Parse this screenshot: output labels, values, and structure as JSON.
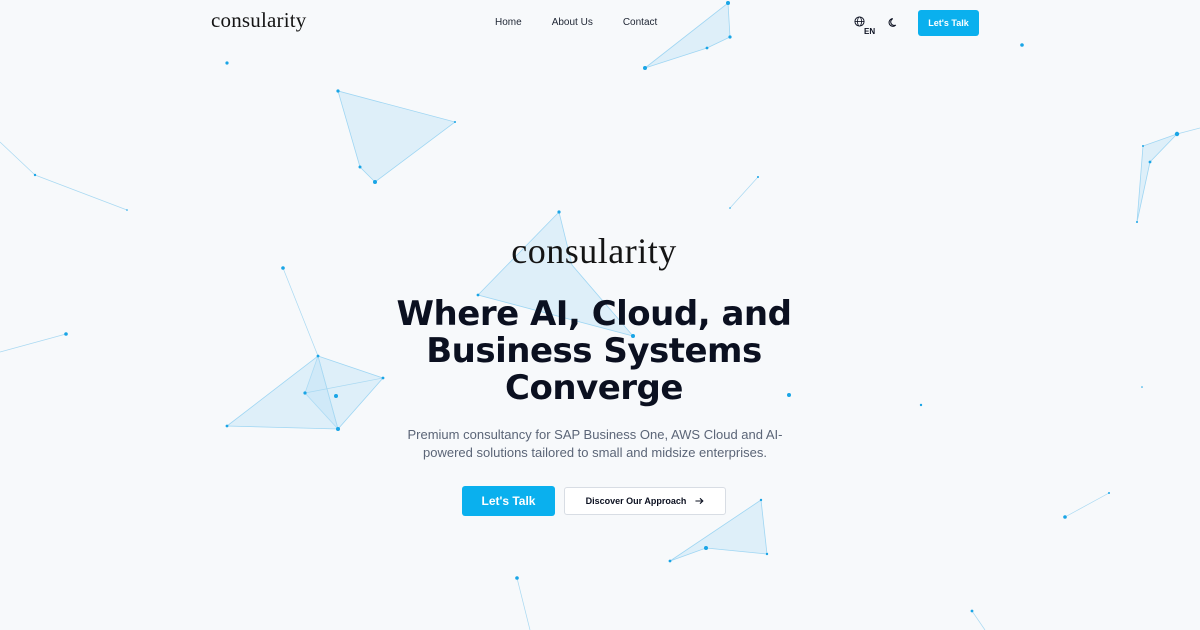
{
  "brand": {
    "logo_text": "consularity"
  },
  "nav": {
    "links": [
      "Home",
      "About Us",
      "Contact"
    ],
    "language": "EN",
    "cta_label": "Let's Talk"
  },
  "hero": {
    "logo_text": "consularity",
    "title": "Where AI, Cloud, and Business Systems Converge",
    "subtitle": "Premium consultancy for SAP Business One, AWS Cloud and AI-powered solutions tailored to small and midsize enterprises.",
    "primary_cta": "Let's Talk",
    "secondary_cta": "Discover Our Approach",
    "secondary_cta_icon": "arrow-right-icon"
  },
  "colors": {
    "accent": "#0ab0ee",
    "background": "#f7f9fb",
    "text": "#0b1020"
  }
}
